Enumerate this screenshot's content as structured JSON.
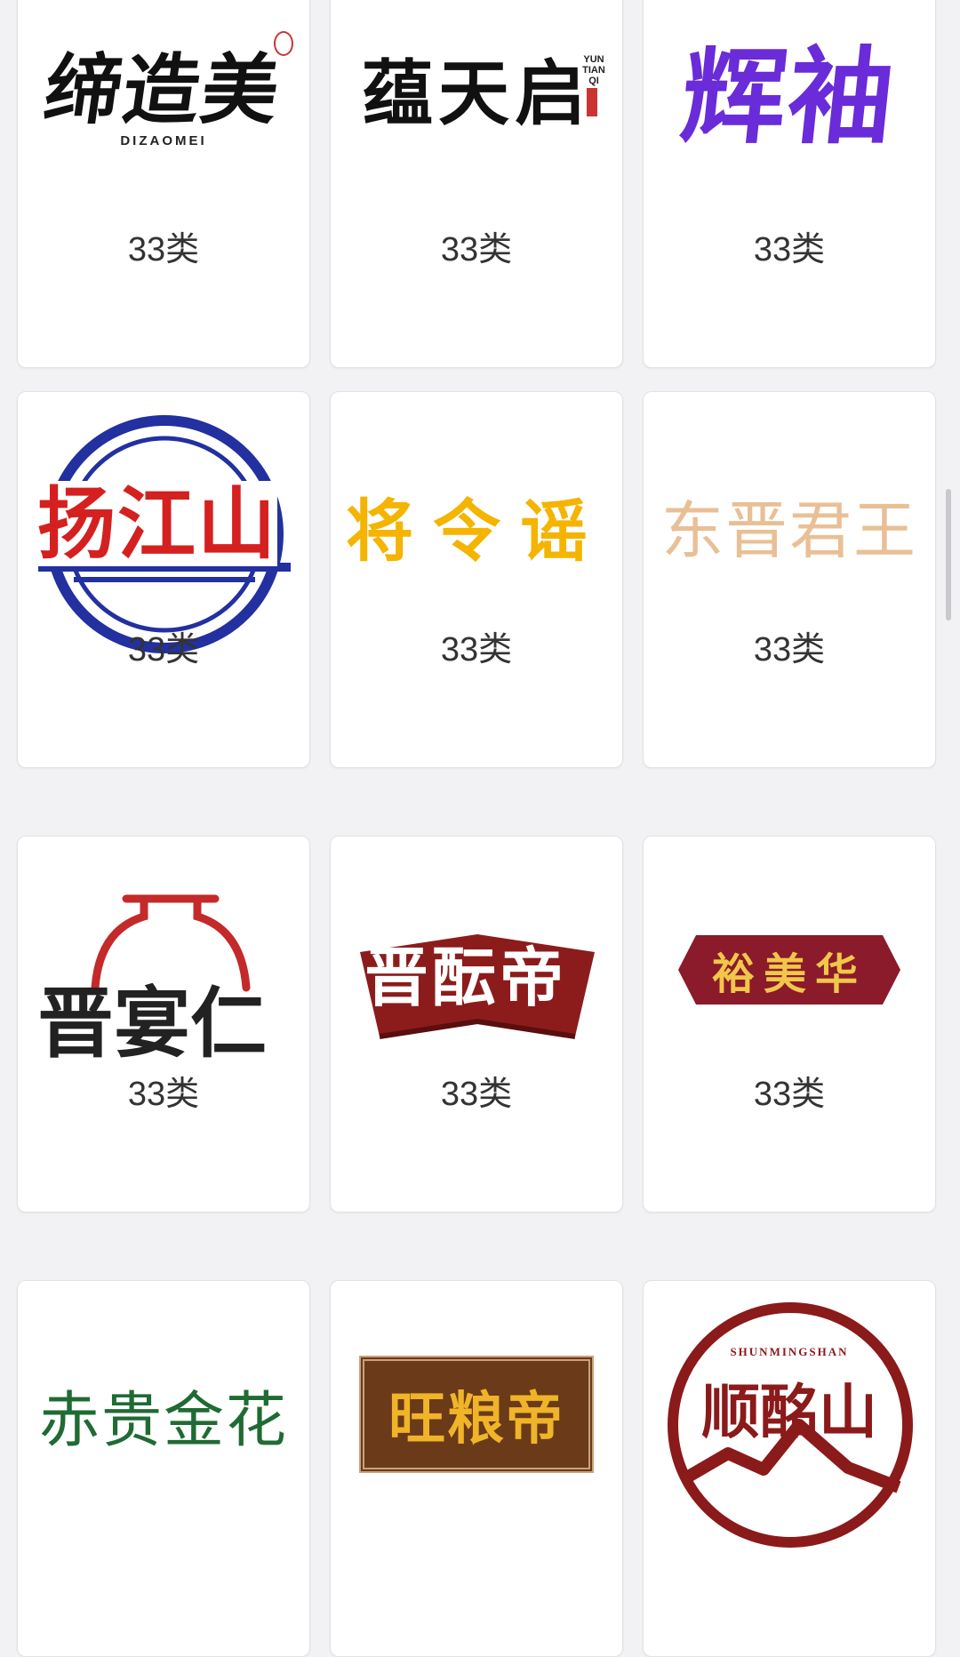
{
  "products": [
    {
      "brand": "缔造美",
      "pinyin": "DIZAOMEI",
      "category": "33类",
      "color": "#111111"
    },
    {
      "brand": "蕴天启",
      "pinyin": "YUN TIAN QI",
      "category": "33类",
      "color": "#111111"
    },
    {
      "brand": "辉袖",
      "category": "33类",
      "color": "#6a2bd9"
    },
    {
      "brand": "扬江山",
      "category": "33类",
      "color": "#d52020",
      "ring_color": "#2230a0"
    },
    {
      "brand": "将令谣",
      "category": "33类",
      "color": "#f4b400"
    },
    {
      "brand": "东晋君王",
      "category": "33类",
      "color": "#e9bf95"
    },
    {
      "brand": "晋宴仁",
      "category": "33类",
      "color": "#222222",
      "accent": "#c42a2a"
    },
    {
      "brand": "晋酝帝",
      "category": "33类",
      "color": "#ffffff",
      "bg": "#8c1c1c"
    },
    {
      "brand": "裕美华",
      "category": "33类",
      "color": "#f0c74a",
      "bg": "#8b1a2b"
    },
    {
      "brand": "赤贵金花",
      "category": "",
      "color": "#1f6b33"
    },
    {
      "brand": "旺粮帝",
      "category": "",
      "color": "#f0b429",
      "bg": "#6b3a18"
    },
    {
      "brand": "顺酩山",
      "pinyin": "SHUNMINGSHAN",
      "category": "",
      "color": "#8b1a1a"
    }
  ]
}
